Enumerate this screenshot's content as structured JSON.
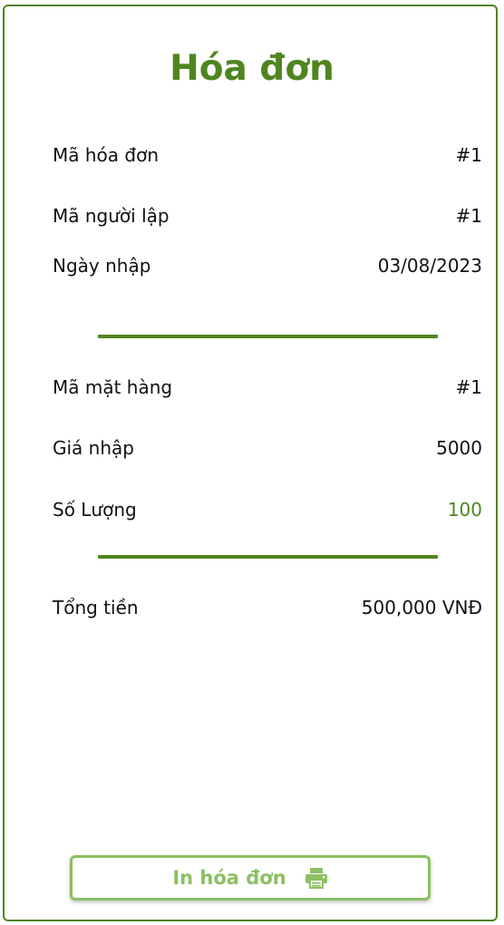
{
  "title": "Hóa đơn",
  "invoice": {
    "invoice_id_label": "Mã hóa đơn",
    "invoice_id_value": "#1",
    "creator_id_label": "Mã người lập",
    "creator_id_value": "#1",
    "import_date_label": "Ngày nhập",
    "import_date_value": "03/08/2023"
  },
  "item": {
    "item_id_label": "Mã mặt hàng",
    "item_id_value": "#1",
    "price_label": "Giá nhập",
    "price_value": "5000",
    "quantity_label": "Số Lượng",
    "quantity_value": "100"
  },
  "total": {
    "label": "Tổng tiền",
    "value": "500,000 VNĐ"
  },
  "print_button": {
    "label": "In hóa đơn",
    "icon": "printer-icon"
  },
  "colors": {
    "accent": "#4f8520",
    "button_accent": "#8cc063"
  }
}
